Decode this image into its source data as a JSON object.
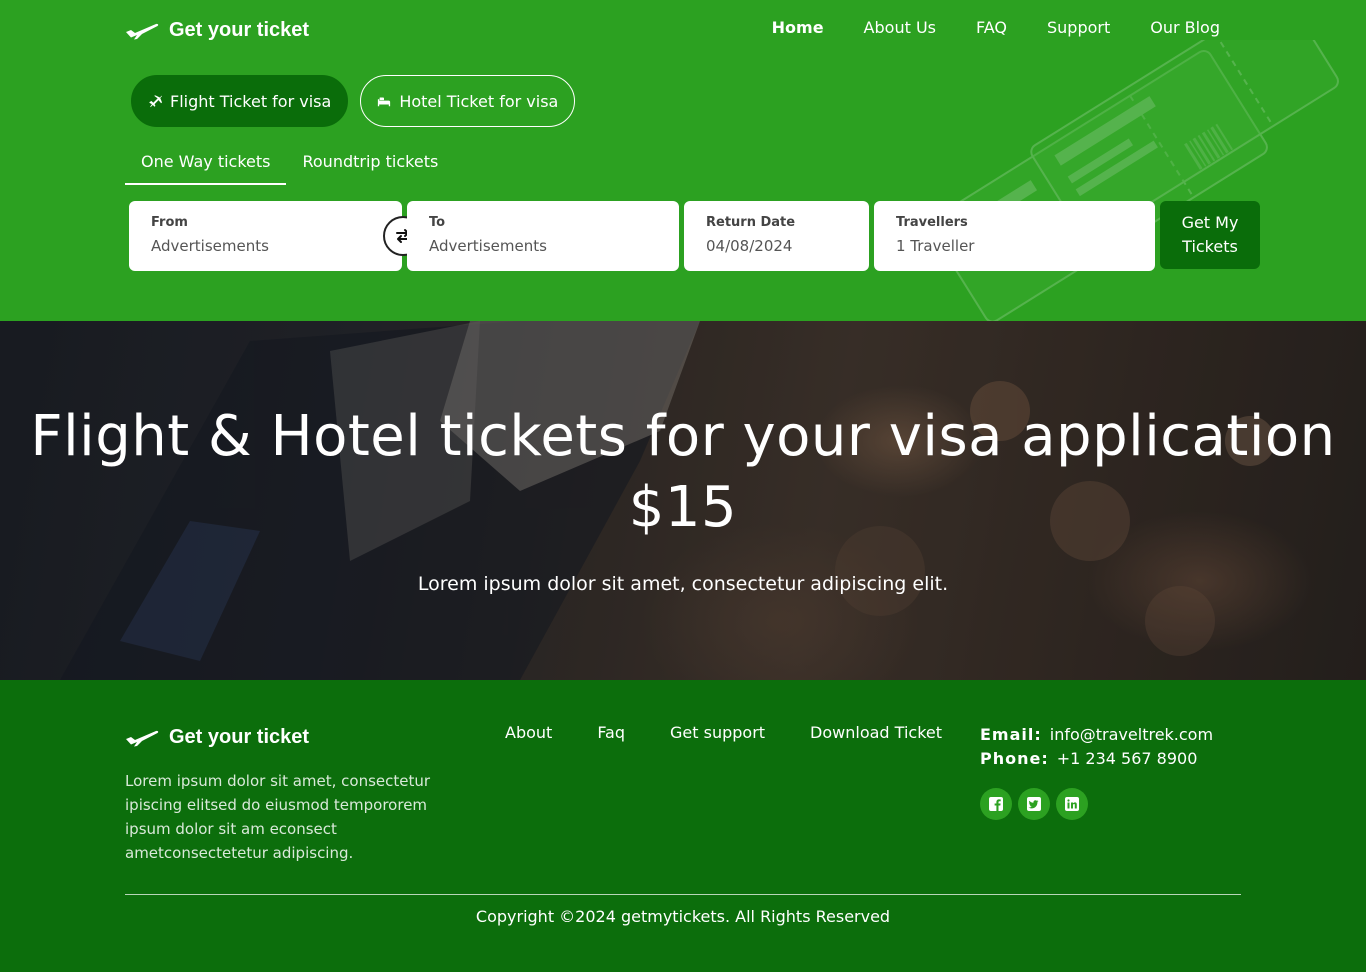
{
  "brand": {
    "name": "Get your ticket",
    "icon": "plane-icon"
  },
  "nav": {
    "items": [
      {
        "label": "Home",
        "active": true
      },
      {
        "label": "About Us",
        "active": false
      },
      {
        "label": "FAQ",
        "active": false
      },
      {
        "label": "Support",
        "active": false
      },
      {
        "label": "Our Blog",
        "active": false
      }
    ]
  },
  "ticket_types": [
    {
      "label": "Flight Ticket for visa",
      "icon": "plane-icon",
      "active": true
    },
    {
      "label": "Hotel Ticket for visa",
      "icon": "bed-icon",
      "active": false
    }
  ],
  "trip_types": [
    {
      "label": "One Way tickets",
      "active": true
    },
    {
      "label": "Roundtrip tickets",
      "active": false
    }
  ],
  "search_form": {
    "from": {
      "label": "From",
      "value": "Advertisements"
    },
    "to": {
      "label": "To",
      "value": "Advertisements"
    },
    "return_date": {
      "label": "Return Date",
      "value": "04/08/2024"
    },
    "travellers": {
      "label": "Travellers",
      "value": "1 Traveller"
    },
    "submit_label": "Get My Tickets",
    "swap_icon": "swap-arrows-icon"
  },
  "hero": {
    "title": "Flight & Hotel tickets for your visa application $15",
    "subtitle": "Lorem ipsum dolor sit amet, consectetur adipiscing elit."
  },
  "footer": {
    "brand": "Get your ticket",
    "about": "Lorem ipsum dolor sit amet, consectetur ipiscing elitsed do eiusmod tempororem ipsum dolor sit am econsect ametconsectetetur adipiscing.",
    "links": [
      "About",
      "Faq",
      "Get support",
      "Download Ticket"
    ],
    "contact": {
      "email_label": "Email:",
      "email": "info@traveltrek.com",
      "phone_label": "Phone:",
      "phone": "+1 234 567 8900"
    },
    "socials": [
      "facebook-icon",
      "twitter-icon",
      "linkedin-icon"
    ],
    "copyright": "Copyright ©2024 getmytickets. All Rights Reserved"
  },
  "colors": {
    "primary_green": "#2ca121",
    "dark_green": "#0a6d0a",
    "footer_green": "#0c6e0c"
  }
}
